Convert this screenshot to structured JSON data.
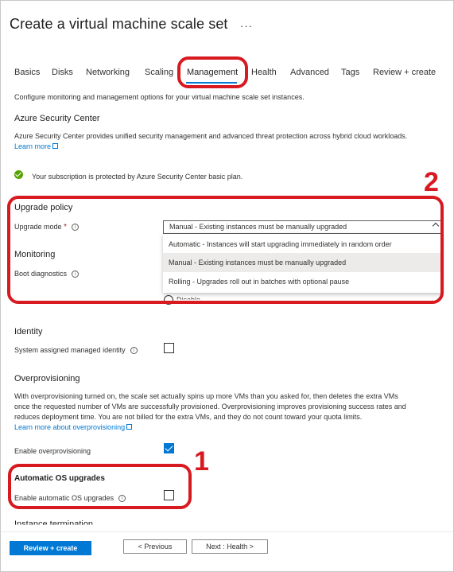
{
  "page": {
    "title": "Create a virtual machine scale set",
    "more": "···"
  },
  "tabs": [
    "Basics",
    "Disks",
    "Networking",
    "Scaling",
    "Management",
    "Health",
    "Advanced",
    "Tags",
    "Review + create"
  ],
  "active_tab": "Management",
  "intro": "Configure monitoring and management options for your virtual machine scale set instances.",
  "security_center": {
    "heading": "Azure Security Center",
    "description": "Azure Security Center provides unified security management and advanced threat protection across hybrid cloud workloads.",
    "learn_more": "Learn more",
    "status": "Your subscription is protected by Azure Security Center basic plan."
  },
  "upgrade_policy": {
    "heading": "Upgrade policy",
    "mode_label": "Upgrade mode",
    "required_mark": "*",
    "selected": "Manual - Existing instances must be manually upgraded",
    "options": [
      "Automatic - Instances will start upgrading immediately in random order",
      "Manual - Existing instances must be manually upgraded",
      "Rolling - Upgrades roll out in batches with optional pause"
    ]
  },
  "monitoring": {
    "heading": "Monitoring",
    "boot_diagnostics_label": "Boot diagnostics",
    "radio_partial": "Disable"
  },
  "identity": {
    "heading": "Identity",
    "managed_identity_label": "System assigned managed identity",
    "managed_identity_checked": false
  },
  "overprovisioning": {
    "heading": "Overprovisioning",
    "description_line1": "With overprovisioning turned on, the scale set actually spins up more VMs than you asked for, then deletes the extra VMs",
    "description_line2": "once the requested number of VMs are successfully provisioned. Overprovisioning improves provisioning success rates and",
    "description_line3": "reduces deployment time. You are not billed for the extra VMs, and they do not count toward your quota limits.",
    "learn_more": "Learn more about overprovisioning",
    "enable_label": "Enable overprovisioning",
    "enable_checked": true
  },
  "auto_os": {
    "heading": "Automatic OS upgrades",
    "enable_label": "Enable automatic OS upgrades",
    "enable_checked": false
  },
  "instance_termination": {
    "heading": "Instance termination"
  },
  "footer": {
    "review_create": "Review + create",
    "previous": "< Previous",
    "next": "Next : Health >"
  },
  "annotations": {
    "callout_1": "1",
    "callout_2": "2",
    "color": "#d71920"
  },
  "colors": {
    "accent": "#0078d4",
    "success": "#57a300",
    "annotation": "#d71920"
  },
  "icons": {
    "info": "info-circle-icon",
    "status": "check-circle-icon",
    "external": "external-link-icon",
    "dropdown": "chevron-down-icon"
  }
}
